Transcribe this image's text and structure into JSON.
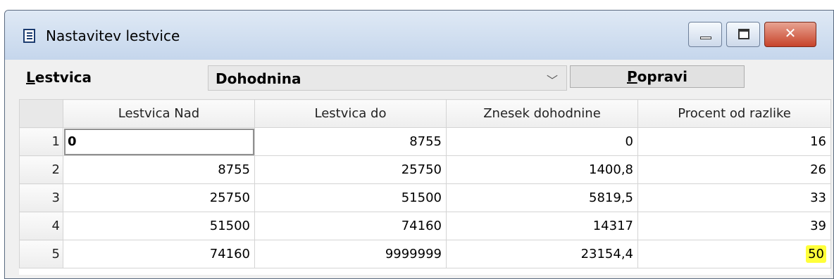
{
  "window": {
    "title": "Nastavitev lestvice",
    "icon": "document-list-icon",
    "close_color": "#c7432a"
  },
  "toolbar": {
    "label_first": "L",
    "label_rest": "estvica",
    "combo_value": "Dohodnina",
    "button_first": "P",
    "button_rest": "opravi"
  },
  "table": {
    "columns": [
      "Lestvica Nad",
      "Lestvica do",
      "Znesek dohodnine",
      "Procent od razlike"
    ],
    "rows": [
      {
        "num": "1",
        "cells": [
          "0",
          "8755",
          "0",
          "16"
        ]
      },
      {
        "num": "2",
        "cells": [
          "8755",
          "25750",
          "1400,8",
          "26"
        ]
      },
      {
        "num": "3",
        "cells": [
          "25750",
          "51500",
          "5819,5",
          "33"
        ]
      },
      {
        "num": "4",
        "cells": [
          "51500",
          "74160",
          "14317",
          "39"
        ]
      },
      {
        "num": "5",
        "cells": [
          "74160",
          "9999999",
          "23154,4",
          "50"
        ]
      }
    ],
    "highlight_color": "#ffff3a"
  }
}
